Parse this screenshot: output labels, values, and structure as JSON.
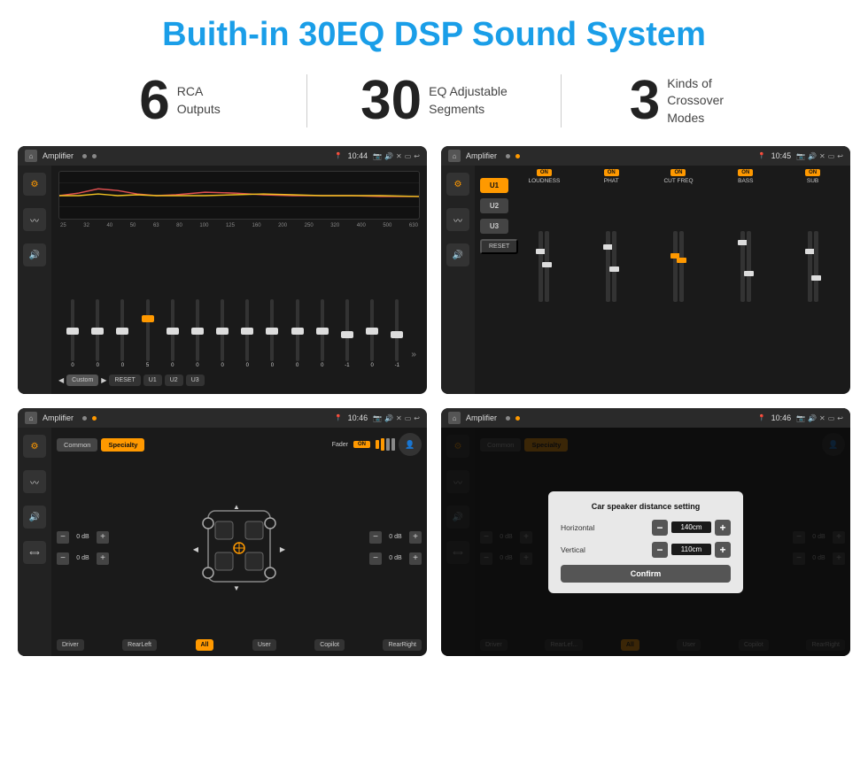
{
  "page": {
    "title": "Buith-in 30EQ DSP Sound System",
    "stats": [
      {
        "number": "6",
        "text": "RCA\nOutputs"
      },
      {
        "number": "30",
        "text": "EQ Adjustable\nSegments"
      },
      {
        "number": "3",
        "text": "Kinds of\nCrossover Modes"
      }
    ]
  },
  "screens": {
    "eq": {
      "title": "Amplifier",
      "time": "10:44",
      "freq_labels": [
        "25",
        "32",
        "40",
        "50",
        "63",
        "80",
        "100",
        "125",
        "160",
        "200",
        "250",
        "320",
        "400",
        "500",
        "630"
      ],
      "values": [
        "0",
        "0",
        "0",
        "5",
        "0",
        "0",
        "0",
        "0",
        "0",
        "0",
        "0",
        "-1",
        "0",
        "-1"
      ],
      "preset": "Custom",
      "buttons": [
        "RESET",
        "U1",
        "U2",
        "U3"
      ]
    },
    "crossover": {
      "title": "Amplifier",
      "time": "10:45",
      "u_buttons": [
        "U1",
        "U2",
        "U3"
      ],
      "channels": [
        {
          "name": "LOUDNESS",
          "on": true
        },
        {
          "name": "PHAT",
          "on": true
        },
        {
          "name": "CUT FREQ",
          "on": true
        },
        {
          "name": "BASS",
          "on": true
        },
        {
          "name": "SUB",
          "on": true
        }
      ],
      "reset_label": "RESET"
    },
    "fader": {
      "title": "Amplifier",
      "time": "10:46",
      "tabs": [
        "Common",
        "Specialty"
      ],
      "fader_label": "Fader",
      "fader_on": "ON",
      "db_controls": [
        {
          "value": "0 dB"
        },
        {
          "value": "0 dB"
        },
        {
          "value": "0 dB"
        },
        {
          "value": "0 dB"
        }
      ],
      "positions": [
        "Driver",
        "RearLeft",
        "All",
        "User",
        "Copilot",
        "RearRight"
      ]
    },
    "dialog": {
      "title": "Amplifier",
      "time": "10:46",
      "dialog_title": "Car speaker distance setting",
      "horizontal_label": "Horizontal",
      "horizontal_value": "140cm",
      "vertical_label": "Vertical",
      "vertical_value": "110cm",
      "confirm_label": "Confirm",
      "db_controls": [
        {
          "value": "0 dB"
        },
        {
          "value": "0 dB"
        }
      ],
      "positions": [
        "Driver",
        "RearLef...",
        "All",
        "User",
        "Copilot",
        "RearRight"
      ]
    }
  },
  "icons": {
    "home": "⌂",
    "back": "↩",
    "location": "📍",
    "camera": "📷",
    "volume": "🔊",
    "close": "✕",
    "minimize": "—",
    "eq_icon": "⚙",
    "wave_icon": "〰",
    "speaker_icon": "🔊"
  }
}
